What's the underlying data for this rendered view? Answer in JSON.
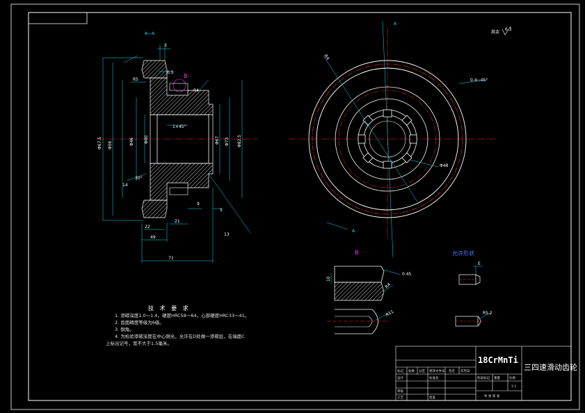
{
  "labels": {
    "section_aa": "A—A",
    "section_a_top": "A",
    "section_a_bottom": "A",
    "roughness": "其余",
    "roughness_val": "6.3",
    "detail_b": "B",
    "allowed_shape": "允许形状",
    "tech_title": "技 术 要 求",
    "tech_1": "1. 渗碳深度1.0～1.4，硬度HRC58～64，心部硬度HRC33～41。",
    "tech_2": "2. 齿面精度等级为6级。",
    "tech_3": "3. 倒角。",
    "tech_4": "4. 为检验渗碳深度在中心侧允，允许在D处做一渗碳层，在端面C",
    "tech_4b": "上标出记号，宽不大于1.5毫米。"
  },
  "dims": {
    "d3": "3",
    "d05": "0.5",
    "r5": "R5",
    "d675": "Φ67.5",
    "d56": "Φ56",
    "d46": "Φ46",
    "d40": "Φ40",
    "d67": "Φ67",
    "d73": "Φ73",
    "d825": "Φ82.5",
    "chamfer": "1×45°",
    "ang30": "30°",
    "d14": "14",
    "d22": "22",
    "d21": "21",
    "d49": "49",
    "d71": "71",
    "d13": "13",
    "d5": "5",
    "d9": "9",
    "r4": "R4",
    "c045": "0.4~45°",
    "d48": "Φ48",
    "d10": "10",
    "r11": "R11",
    "r52": "R5.2",
    "d045": "0.45",
    "e": "E",
    "d14b": "14"
  },
  "title_block": {
    "material": "18CrMnTi",
    "part_name": "三四速滑动齿轮",
    "h1": "标记",
    "h2": "处数",
    "h3": "分区",
    "h4": "更改文件号",
    "h5": "签名",
    "h6": "年月日",
    "design": "设计",
    "std": "标准化",
    "check": "审核",
    "process": "工艺",
    "approve": "批准",
    "stage": "阶段标记",
    "weight": "重量",
    "scale": "比例",
    "ratio": "1:1",
    "sheet": "共 张  第 张"
  }
}
